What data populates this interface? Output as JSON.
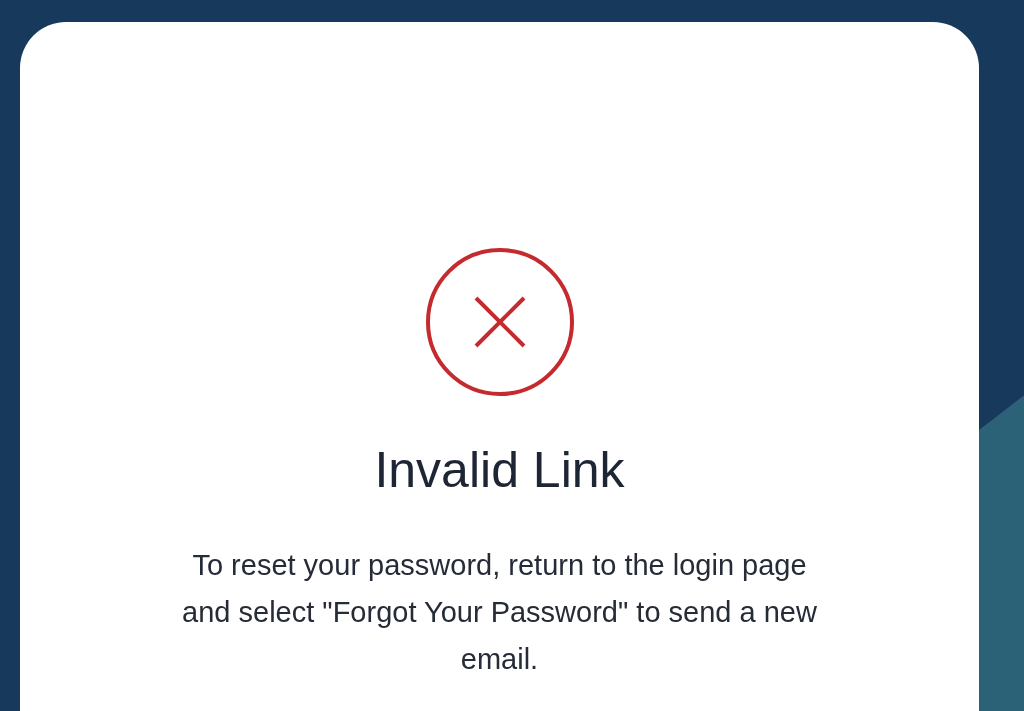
{
  "card": {
    "title": "Invalid Link",
    "message": "To reset your password, return to the login page and select \"Forgot Your Password\" to send a new email."
  }
}
